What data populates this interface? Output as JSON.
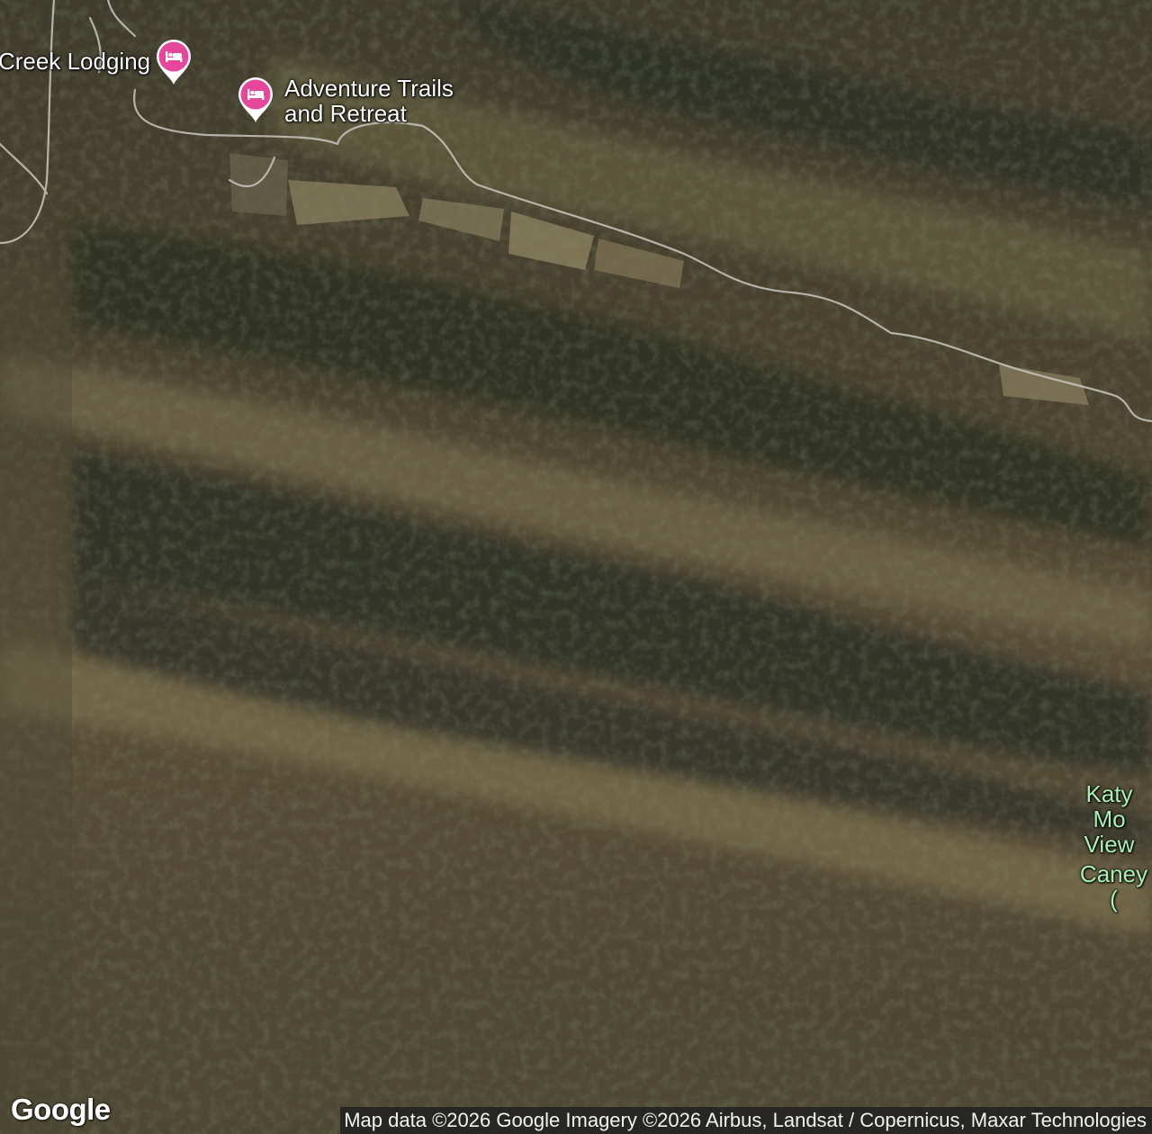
{
  "map": {
    "type": "satellite",
    "markers": [
      {
        "id": "lodging1",
        "label": "Creek Lodging",
        "icon": "lodging-icon",
        "color": "#e6479a"
      },
      {
        "id": "lodging2",
        "label": "Adventure Trails\nand Retreat",
        "icon": "lodging-icon",
        "color": "#e6479a"
      }
    ],
    "places": [
      {
        "id": "katy",
        "label": "Katy Mo\nView"
      },
      {
        "id": "caney",
        "label": "Caney ("
      }
    ]
  },
  "footer": {
    "logo": "Google",
    "attribution": "Map data ©2026 Google Imagery ©2026 Airbus, Landsat / Copernicus, Maxar Technologies"
  },
  "colors": {
    "poi_pink": "#e6479a",
    "road": "#c8c8c0",
    "place_green": "#a8f0b4"
  }
}
